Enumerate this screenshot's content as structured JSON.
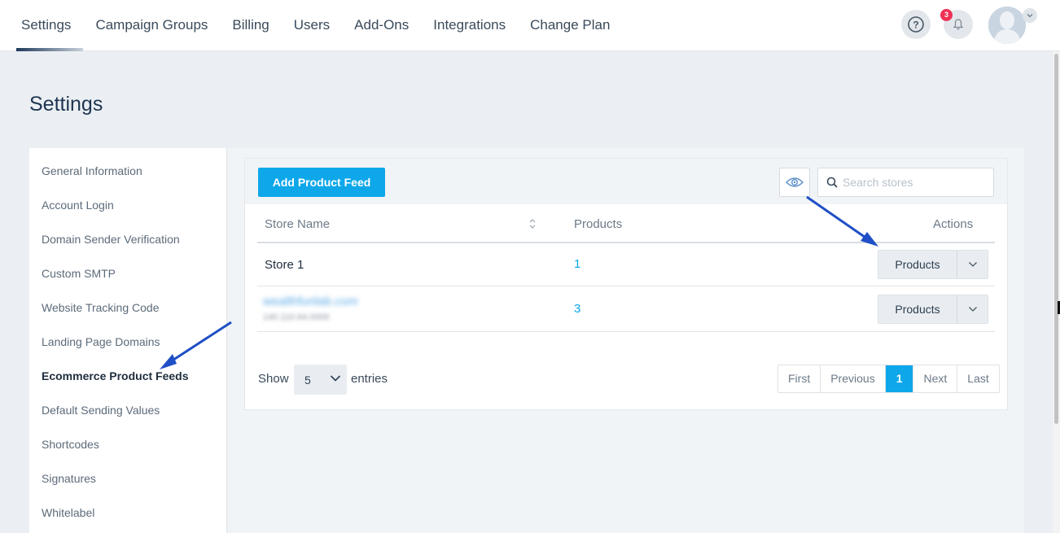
{
  "nav": {
    "items": [
      {
        "label": "Settings",
        "active": true
      },
      {
        "label": "Campaign Groups"
      },
      {
        "label": "Billing"
      },
      {
        "label": "Users"
      },
      {
        "label": "Add-Ons"
      },
      {
        "label": "Integrations"
      },
      {
        "label": "Change Plan"
      }
    ],
    "help_icon": "question-circle-icon",
    "bell_icon": "bell-icon",
    "notification_count": "3"
  },
  "page": {
    "title": "Settings"
  },
  "sidebar": {
    "items": [
      {
        "label": "General Information"
      },
      {
        "label": "Account Login"
      },
      {
        "label": "Domain Sender Verification"
      },
      {
        "label": "Custom SMTP"
      },
      {
        "label": "Website Tracking Code"
      },
      {
        "label": "Landing Page Domains"
      },
      {
        "label": "Ecommerce Product Feeds",
        "active": true
      },
      {
        "label": "Default Sending Values"
      },
      {
        "label": "Shortcodes"
      },
      {
        "label": "Signatures"
      },
      {
        "label": "Whitelabel"
      }
    ]
  },
  "toolbar": {
    "add_label": "Add Product Feed",
    "search_placeholder": "Search stores"
  },
  "table": {
    "headers": {
      "store": "Store Name",
      "products": "Products",
      "actions": "Actions"
    },
    "rows": [
      {
        "store": "Store 1",
        "products": "1",
        "action_label": "Products"
      },
      {
        "store": "wealthfunlab.com",
        "store_sub": "140.110.64.0000",
        "products": "3",
        "action_label": "Products"
      }
    ]
  },
  "footer": {
    "show_label": "Show",
    "entries_value": "5",
    "entries_label": "entries",
    "pagination": [
      "First",
      "Previous",
      "1",
      "Next",
      "Last"
    ]
  },
  "colors": {
    "accent": "#0ea7ea",
    "annotation_arrow": "#1f4fc6",
    "badge": "#ef3054"
  }
}
